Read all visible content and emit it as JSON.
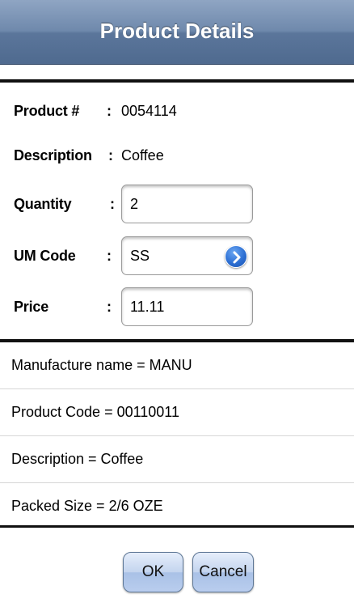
{
  "nav": {
    "title": "Product Details"
  },
  "form": {
    "product_number": {
      "label": "Product #",
      "value": "0054114"
    },
    "description": {
      "label": "Description",
      "value": "Coffee"
    },
    "quantity": {
      "label": "Quantity",
      "value": "2"
    },
    "um_code": {
      "label": "UM Code",
      "value": "SS"
    },
    "price": {
      "label": "Price",
      "value": "11.11"
    },
    "colon": ":"
  },
  "info": [
    "Manufacture name = MANU",
    "Product Code = 00110011",
    "Description = Coffee",
    "Packed Size = 2/6 OZE"
  ],
  "buttons": {
    "ok": "OK",
    "cancel": "Cancel"
  },
  "colors": {
    "nav_bar": "#6f89ac",
    "button": "#b9cdee",
    "disclosure": "#2d6fd3"
  }
}
